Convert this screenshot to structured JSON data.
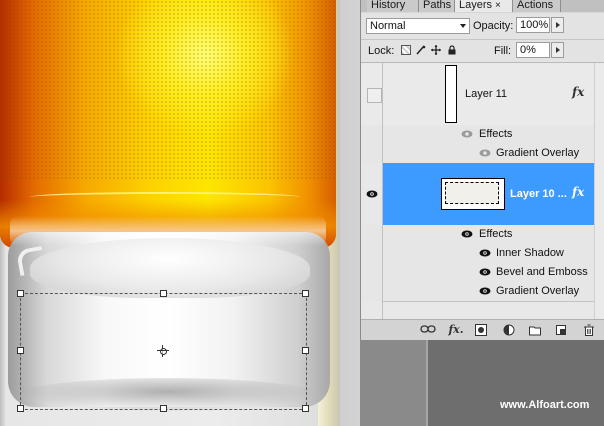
{
  "tabs": {
    "history": "History",
    "paths": "Paths",
    "layers": "Layers",
    "layers_close": "×",
    "actions": "Actions"
  },
  "blend": {
    "mode": "Normal",
    "opacity_label": "Opacity:",
    "opacity_value": "100%"
  },
  "lock": {
    "label": "Lock:",
    "fill_label": "Fill:",
    "fill_value": "0%"
  },
  "layers": [
    {
      "name": "Layer 11",
      "visible": false,
      "selected": false,
      "fx": "fx",
      "effects_label": "Effects",
      "effects": [
        "Gradient Overlay"
      ]
    },
    {
      "name": "Layer 10 ...",
      "visible": true,
      "selected": true,
      "fx": "fx",
      "effects_label": "Effects",
      "effects": [
        "Inner Shadow",
        "Bevel and Emboss",
        "Gradient Overlay"
      ]
    }
  ],
  "watermark": "www.Alfoart.com",
  "colors": {
    "selected_row": "#3d9bff",
    "panel_bg": "#d6d6d6",
    "list_bg": "#e8e8e8"
  },
  "icons": [
    "eye-icon",
    "fx-icon",
    "link-layers-icon",
    "add-style-icon",
    "add-mask-icon",
    "adjustment-layer-icon",
    "new-group-icon",
    "new-layer-icon",
    "trash-icon",
    "lock-transparent-icon",
    "lock-image-icon",
    "lock-position-icon",
    "lock-all-icon"
  ]
}
